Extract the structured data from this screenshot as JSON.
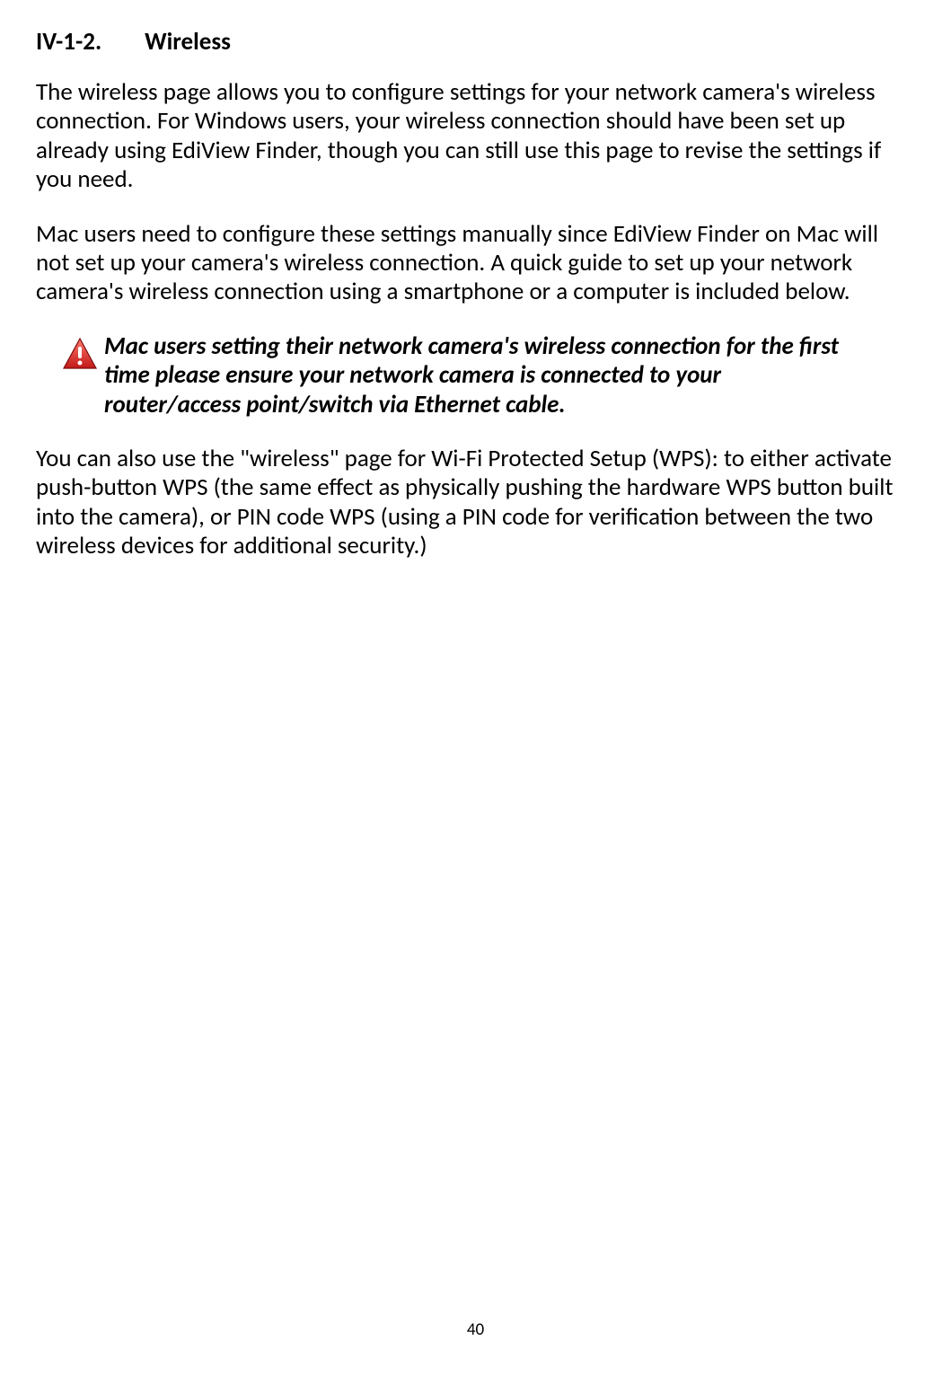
{
  "heading": {
    "number": "IV-1-2.",
    "title": "Wireless"
  },
  "para1": "The wireless page allows you to configure settings for your network camera's wireless connection. For Windows users, your wireless connection should have been set up already using EdiView Finder, though you can still use this page to revise the settings if you need.",
  "para2": "Mac users need to configure these settings manually since EdiView Finder on Mac will not set up your camera's wireless connection. A quick guide to set up your network camera's wireless connection using a smartphone or a computer is included below.",
  "note": "Mac users setting their network camera's wireless connection for the first time please ensure your network camera is connected to your router/access point/switch via Ethernet cable.",
  "para3": "You can also use the \"wireless\" page for Wi-Fi Protected Setup (WPS): to either activate push-button WPS (the same effect as physically pushing the hardware WPS button built into the camera), or PIN code WPS (using a PIN code for verification between the two wireless devices for additional security.)",
  "pageNumber": "40"
}
